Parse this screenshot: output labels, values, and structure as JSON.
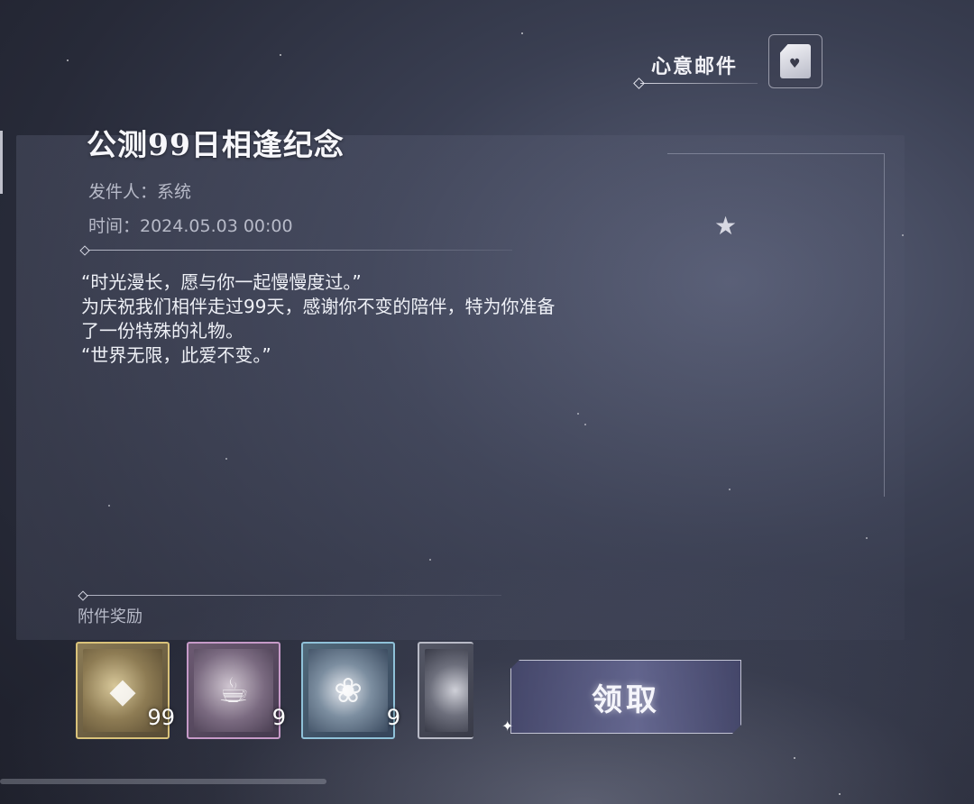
{
  "mail_tag": {
    "label": "心意邮件",
    "icon": "heart-letter-icon"
  },
  "mail": {
    "title": "公测99日相逢纪念",
    "sender": "发件人：系统",
    "time": "时间：2024.05.03 00:00",
    "body": [
      "“时光漫长，愿与你一起慢慢度过。”",
      "为庆祝我们相伴走过99天，感谢你不变的陪伴，特为你准备",
      "了一份特殊的礼物。",
      "“世界无限，此爱不变。”"
    ]
  },
  "rewards": {
    "label": "附件奖励",
    "items": [
      {
        "icon": "gold-crystal-icon",
        "count": "99",
        "rarity_color": "#d9c27a"
      },
      {
        "icon": "cup-icon",
        "count": "9",
        "rarity_color": "#c69ac8"
      },
      {
        "icon": "rose-icon",
        "count": "9",
        "rarity_color": "#8fc1d8"
      },
      {
        "icon": "heart-stone-icon",
        "count": "",
        "rarity_color": "#b8bac6"
      }
    ]
  },
  "claim_button": {
    "label": "领取"
  }
}
